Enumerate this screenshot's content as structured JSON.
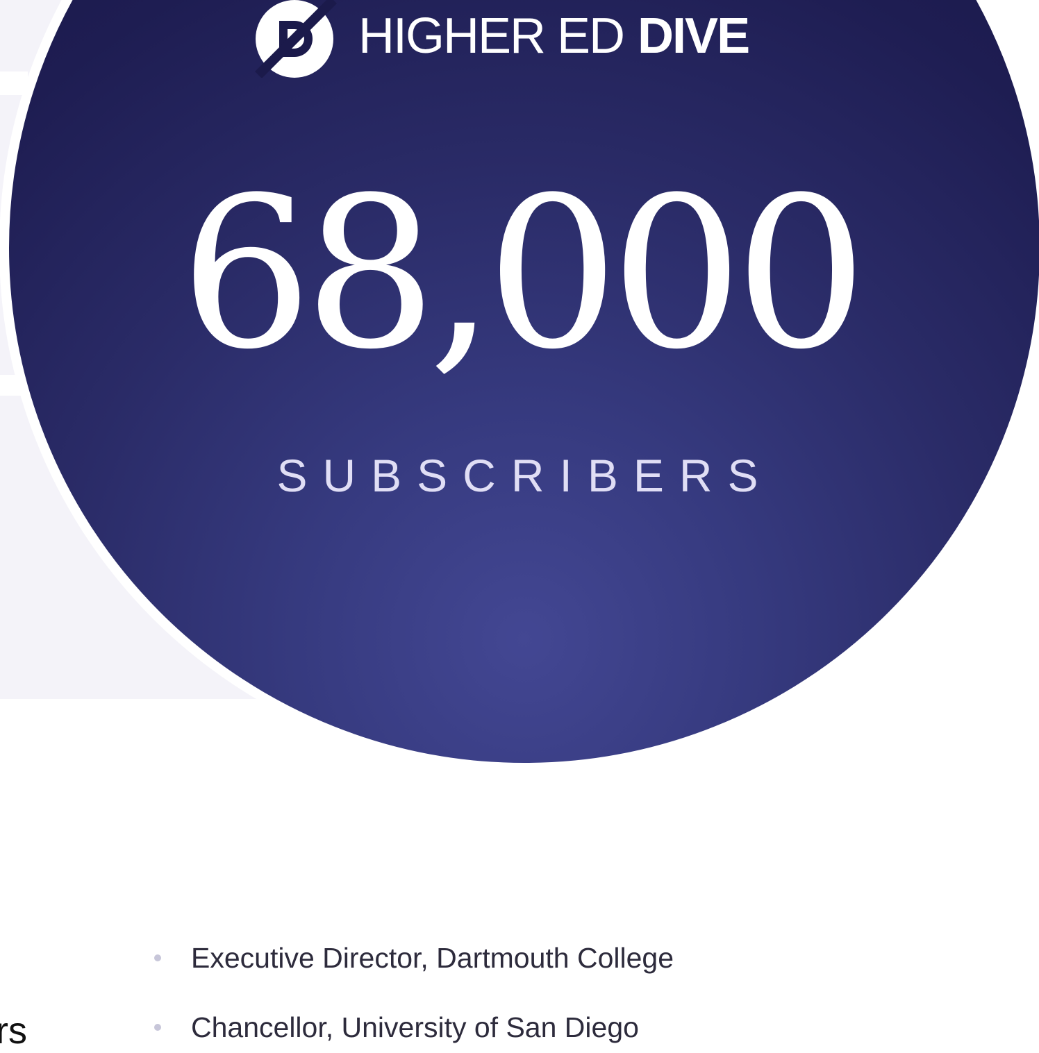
{
  "brand": {
    "name_light": "HIGHER ED",
    "name_bold": "DIVE",
    "icon": "dive-logo-icon"
  },
  "stat": {
    "value": "68,000",
    "label": "SUBSCRIBERS"
  },
  "readers": [
    "Executive Director, Dartmouth College",
    "Chancellor, University of San Diego"
  ],
  "left_fragment": "rs",
  "colors": {
    "circle_dark": "#161645",
    "circle_light": "#434793",
    "label_text": "#e0def5",
    "body_text": "#2d2b3c",
    "bullet": "#c7c6d9",
    "panel": "#f4f3f9"
  }
}
